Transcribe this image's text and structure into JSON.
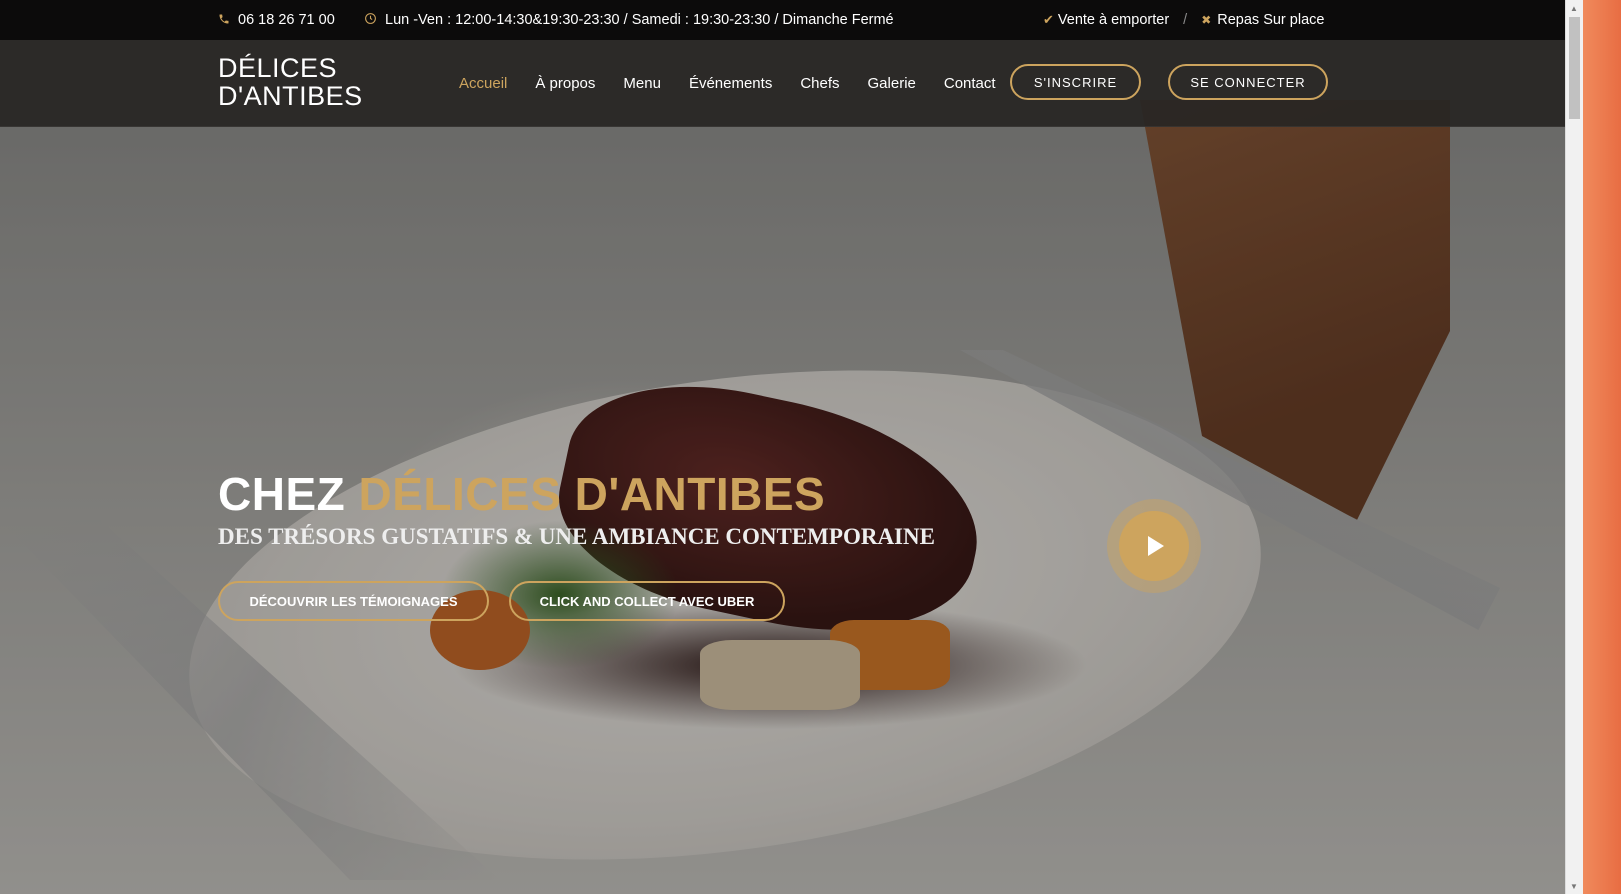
{
  "topbar": {
    "phone": "06 18 26 71 00",
    "hours": "Lun -Ven : 12:00-14:30&19:30-23:30 / Samedi : 19:30-23:30 / Dimanche Fermé",
    "takeaway": "Vente à emporter",
    "separator": "/",
    "dine_in": "Repas Sur place"
  },
  "navbar": {
    "logo_line1": "DÉLICES",
    "logo_line2": "D'ANTIBES",
    "links": [
      "Accueil",
      "À propos",
      "Menu",
      "Événements",
      "Chefs",
      "Galerie",
      "Contact"
    ],
    "active_link": "Accueil",
    "register_label": "S'INSCRIRE",
    "login_label": "SE CONNECTER"
  },
  "hero": {
    "title_prefix": "CHEZ",
    "title_accent": "DÉLICES D'ANTIBES",
    "subtitle": "DES TRÉSORS GUSTATIFS & UNE AMBIANCE CONTEMPORAINE",
    "btn_testimonials": "DÉCOUVRIR LES TÉMOIGNAGES",
    "btn_collect": "CLICK AND COLLECT AVEC UBER"
  },
  "icons": {
    "phone": "phone-icon",
    "clock": "clock-icon",
    "check": "check-icon",
    "cross": "cross-icon",
    "play": "play-icon"
  },
  "colors": {
    "accent": "#cda45e",
    "topbar_bg": "#0c0b0b",
    "navbar_bg": "#282624"
  }
}
